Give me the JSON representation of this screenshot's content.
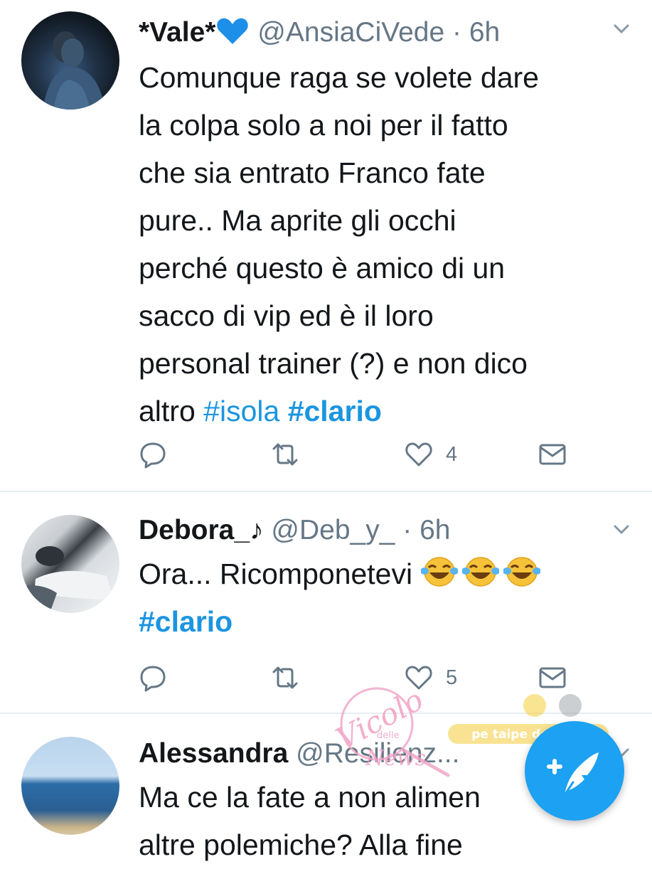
{
  "tweets": [
    {
      "name": "*Vale*",
      "name_emoji": "blue-heart",
      "handle": "@AnsiaCiVede",
      "time": "· 6h",
      "text": "Comunque raga se volete dare\nla colpa solo a noi per il fatto\nche sia entrato Franco fate\npure.. Ma aprite gli occhi\nperché questo è amico di un\nsacco di vip ed è il loro\npersonal trainer (?) e non dico\naltro ",
      "hashtags": [
        "#isola",
        "#clario"
      ],
      "likes": "4"
    },
    {
      "name": "Debora_♪",
      "handle": "@Deb_y_",
      "time": "· 6h",
      "text": "Ora... Ricomponetevi ",
      "emojis": [
        "tears-of-joy",
        "tears-of-joy",
        "tears-of-joy"
      ],
      "hashtags": [
        "#clario"
      ],
      "likes": "5"
    },
    {
      "name": "Alessandra",
      "handle": "@Resilienz...",
      "text": "Ma ce la fate a non alimen\naltre polemiche? Alla fine"
    }
  ],
  "watermark": {
    "script": "Vicolo",
    "small": "delle",
    "script2": "News",
    "banner": "pe taipe del web"
  },
  "colors": {
    "accent": "#1da1f2",
    "hashtag": "#1b95e0",
    "secondary_text": "#657786",
    "heart_blue": "#1d8fe8",
    "divider": "#e6ecf0"
  },
  "icons": [
    "reply-icon",
    "retweet-icon",
    "like-icon",
    "dm-icon",
    "chevron-down-icon",
    "compose-tweet-icon"
  ]
}
